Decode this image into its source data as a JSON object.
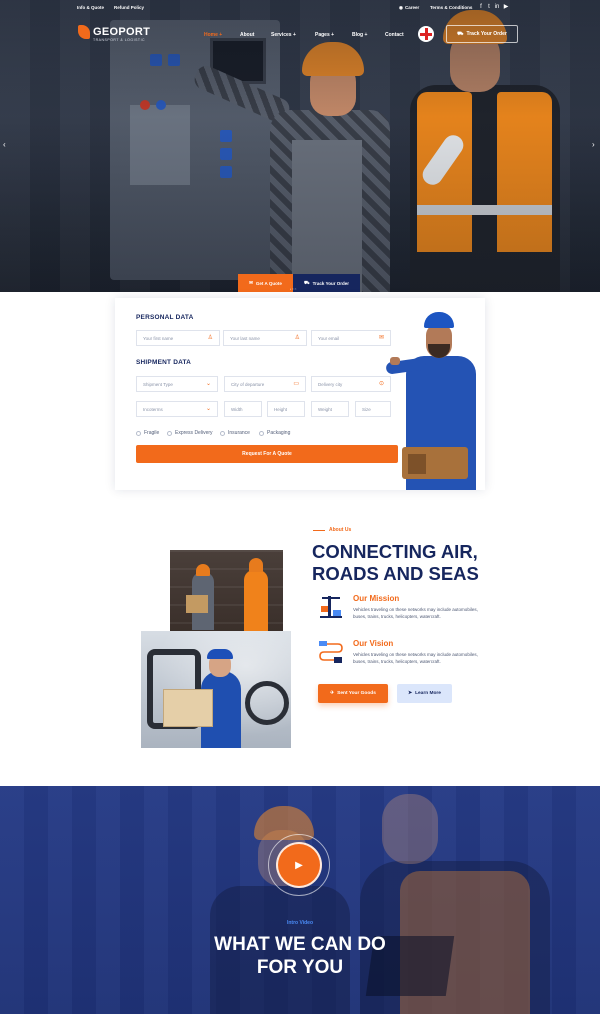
{
  "topbar": {
    "links": [
      "Info & Quote",
      "Refund Policy"
    ],
    "career": "Career",
    "terms": "Terms & Conditions",
    "social_icons": [
      "facebook-icon",
      "twitter-icon",
      "linkedin-icon",
      "youtube-icon"
    ]
  },
  "brand": {
    "name": "GEOPORT",
    "tagline": "TRANSPORT & LOGISTIC"
  },
  "nav": {
    "items": [
      {
        "label": "Home +",
        "active": true
      },
      {
        "label": "About",
        "active": false
      },
      {
        "label": "Services +",
        "active": false
      },
      {
        "label": "Pages +",
        "active": false
      },
      {
        "label": "Blog +",
        "active": false
      },
      {
        "label": "Contact",
        "active": false
      }
    ],
    "track_order": "Track Your Order"
  },
  "hero": {
    "tab_quote": "Get A Quote",
    "tab_track": "Track Your Order"
  },
  "quote_form": {
    "personal_title": "PERSONAL DATA",
    "first_name_placeholder": "Your first name",
    "last_name_placeholder": "Your last name",
    "email_placeholder": "Your email",
    "shipment_title": "SHIPMENT DATA",
    "shipment_type": "Shipment Type",
    "city_departure": "City of departure",
    "delivery_city": "Delivery city",
    "incoterms": "Incoterms",
    "width": "Width",
    "height": "Height",
    "weight": "Weight",
    "size": "Size",
    "options": [
      "Fragile",
      "Express Delivery",
      "Insurance",
      "Packaging"
    ],
    "submit": "Request For A Quote"
  },
  "about": {
    "tag": "About Us",
    "title_line1": "CONNECTING AIR,",
    "title_line2": "ROADS AND SEAS",
    "mission_title": "Our Mission",
    "mission_text": "Vehicles traveling on these networks may include automobiles, buses, trains, trucks, helicopters, watercraft.",
    "vision_title": "Our Vision",
    "vision_text": "Vehicles traveling on these networks may include automobiles, buses, trains, trucks, helicopters, watercraft.",
    "btn_send": "Sent Your Goods",
    "btn_learn": "Learn More"
  },
  "video": {
    "tag": "Intro Video",
    "title_line1": "WHAT WE CAN DO",
    "title_line2": "FOR YOU"
  },
  "colors": {
    "accent": "#f26a1b",
    "navy": "#16265e",
    "video_bg": "#263b86"
  }
}
